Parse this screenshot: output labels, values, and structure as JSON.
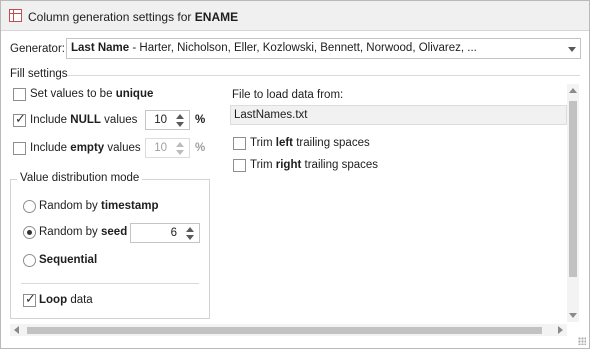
{
  "title": {
    "prefix": "Column generation settings for",
    "column": "ENAME"
  },
  "generator": {
    "label": "Generator:",
    "selected_name": "Last Name",
    "selected_detail": " - Harter, Nicholson, Eller, Kozlowski, Bennett, Norwood, Olivarez, ..."
  },
  "fill_settings": {
    "heading": "Fill settings",
    "unique": {
      "label_pre": "Set values to be",
      "label_bold": "unique",
      "label_post": "",
      "checked": false
    },
    "include_null": {
      "label_pre": "Include",
      "label_bold": "NULL",
      "label_post": "values",
      "checked": true,
      "value": "10",
      "unit": "%"
    },
    "include_empty": {
      "label_pre": "Include",
      "label_bold": "empty",
      "label_post": "values",
      "checked": false,
      "value": "10",
      "unit": "%",
      "enabled": false
    }
  },
  "distribution": {
    "heading": "Value distribution mode",
    "random_timestamp": {
      "label_pre": "Random by",
      "label_bold": "timestamp",
      "selected": false
    },
    "random_seed": {
      "label_pre": "Random by",
      "label_bold": "seed",
      "selected": true,
      "seed_value": "6"
    },
    "sequential": {
      "label_bold": "Sequential",
      "selected": false
    },
    "loop": {
      "label_bold": "Loop",
      "label_post": "data",
      "checked": true
    }
  },
  "file": {
    "label": "File to load data from:",
    "value": "LastNames.txt",
    "trim_left": {
      "label_pre": "Trim",
      "label_bold": "left",
      "label_post": "trailing spaces",
      "checked": false
    },
    "trim_right": {
      "label_pre": "Trim",
      "label_bold": "right",
      "label_post": "trailing spaces",
      "checked": false
    }
  },
  "icons": {
    "title_icon": "table-column-icon",
    "combo_arrow": "chevron-down-icon",
    "check": "checkmark-icon"
  },
  "colors": {
    "title_icon": "#c0504d",
    "titlebar_bg": "#f0f0f0",
    "scroll_thumb": "#c2c2c2"
  }
}
